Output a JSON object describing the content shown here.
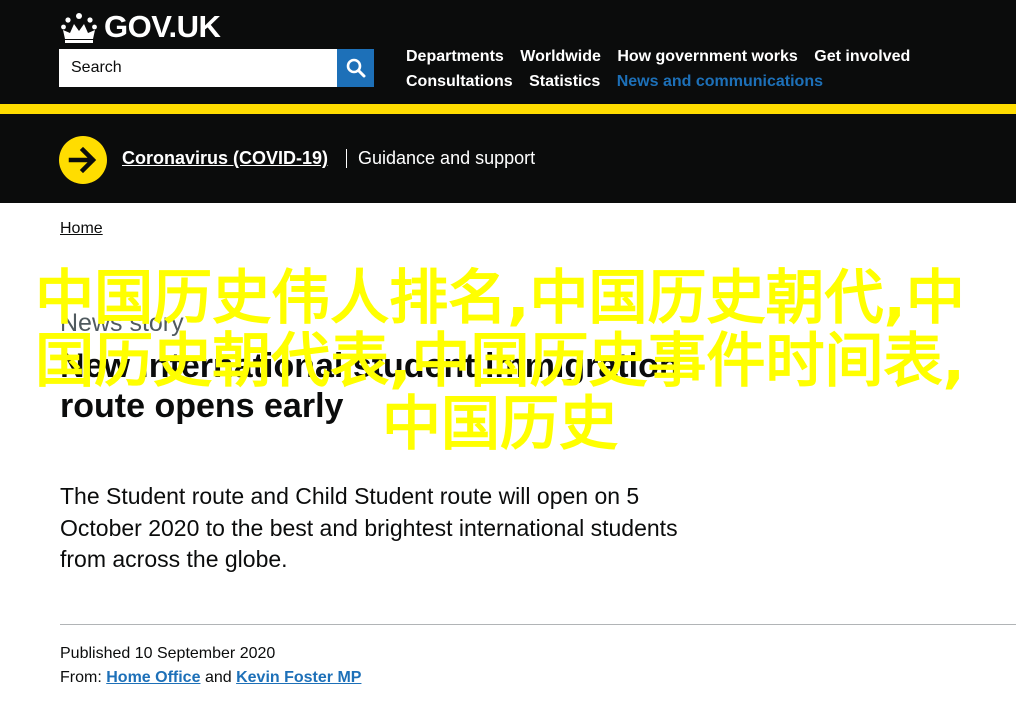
{
  "header": {
    "logo_text": "GOV.UK",
    "search_placeholder": "Search",
    "nav": [
      {
        "label": "Departments"
      },
      {
        "label": "Worldwide"
      },
      {
        "label": "How government works"
      },
      {
        "label": "Get involved"
      },
      {
        "label": "Consultations"
      },
      {
        "label": "Statistics"
      },
      {
        "label": "News and communications",
        "active": true
      }
    ]
  },
  "covid_banner": {
    "link_label": "Coronavirus (COVID-19)",
    "text": "Guidance and support"
  },
  "breadcrumb": {
    "home_label": "Home"
  },
  "article": {
    "caption": "News story",
    "title": "New international student immigration route opens early",
    "lead": "The Student route and Child Student route will open on 5 October 2020 to the best and brightest international students from across the globe.",
    "published_label": "Published",
    "published_date": "10 September 2020",
    "from_label": "From:",
    "from_org": "Home Office",
    "and_label": "and",
    "from_person": "Kevin Foster MP"
  },
  "watermark": {
    "text": "中国历史伟人排名,中国历史朝代,中国历史朝代表,中国历史事件时间表,中国历史"
  },
  "colors": {
    "header_bg": "#0b0c0c",
    "accent_yellow": "#ffdd00",
    "link_blue": "#1d70b8",
    "watermark": "#ffff00"
  }
}
